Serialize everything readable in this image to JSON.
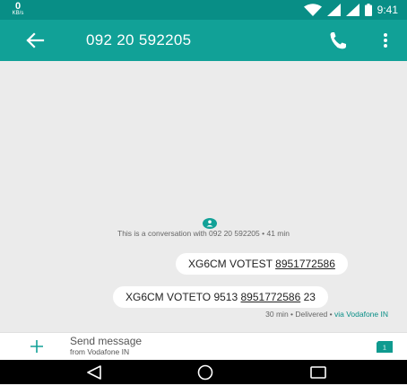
{
  "status_bar": {
    "data_speed": "0",
    "data_unit": "KB/s",
    "time": "9:41",
    "icons": [
      "wifi-icon",
      "signal-icon",
      "signal-icon",
      "battery-icon"
    ],
    "colors": {
      "background": "#088e86",
      "text": "#ffffff"
    }
  },
  "header": {
    "title": "092 20 592205",
    "back_icon": "arrow-left-icon",
    "call_icon": "phone-icon",
    "menu_icon": "more-vert-icon",
    "colors": {
      "background": "#11a197",
      "text": "#ffffff"
    }
  },
  "conversation": {
    "info_icon": "contact-icon",
    "info_text": "This is a conversation with 092 20 592205 • 41 min",
    "messages": [
      {
        "text": "XG6CM VOTEST ",
        "link": "8951772586",
        "suffix": ""
      },
      {
        "text": "XG6CM VOTETO 9513 ",
        "link": "8951772586",
        "suffix": " 23"
      }
    ],
    "status": "30 min • Delivered • ",
    "via": "via Vodafone IN",
    "colors": {
      "background": "#ebebeb",
      "bubble": "#ffffff",
      "accent": "#0a8f87"
    }
  },
  "compose": {
    "add_icon": "plus-icon",
    "placeholder": "Send message",
    "subtitle": "from Vodafone IN",
    "sim_icon": "sim-card-icon",
    "sim_label": "1"
  },
  "nav_bar": {
    "icons": [
      "back-triangle-icon",
      "home-circle-icon",
      "recents-square-icon"
    ]
  }
}
